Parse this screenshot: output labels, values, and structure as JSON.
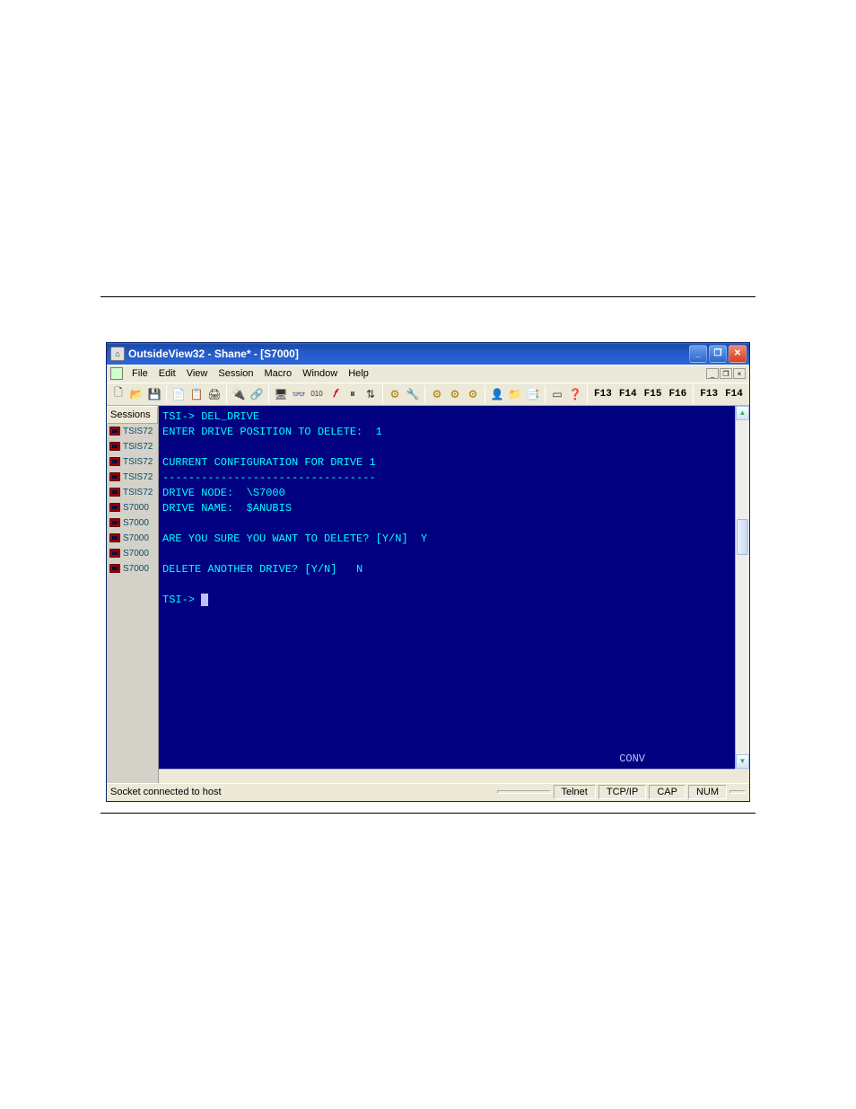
{
  "window": {
    "title": "OutsideView32 - Shane* - [S7000]"
  },
  "menus": [
    "File",
    "Edit",
    "View",
    "Session",
    "Macro",
    "Window",
    "Help"
  ],
  "toolbar": {
    "fkeys_right_a": [
      "F13",
      "F14",
      "F15",
      "F16"
    ],
    "fkeys_right_b": [
      "F13",
      "F14"
    ]
  },
  "sidebar": {
    "header": "Sessions",
    "items": [
      {
        "label": "TSIS72"
      },
      {
        "label": "TSIS72"
      },
      {
        "label": "TSIS72"
      },
      {
        "label": "TSIS72"
      },
      {
        "label": "TSIS72"
      },
      {
        "label": "S7000"
      },
      {
        "label": "S7000"
      },
      {
        "label": "S7000"
      },
      {
        "label": "S7000"
      },
      {
        "label": "S7000"
      }
    ]
  },
  "terminal": {
    "lines": [
      "TSI-> DEL_DRIVE",
      "ENTER DRIVE POSITION TO DELETE:  1",
      "",
      "CURRENT CONFIGURATION FOR DRIVE 1",
      "---------------------------------",
      "DRIVE NODE:  \\S7000",
      "DRIVE NAME:  $ANUBIS",
      "",
      "ARE YOU SURE YOU WANT TO DELETE? [Y/N]  Y",
      "",
      "DELETE ANOTHER DRIVE? [Y/N]   N",
      "",
      "TSI-> "
    ],
    "footer_right": "CONV"
  },
  "statusbar": {
    "message": "Socket connected to host",
    "panes": [
      "",
      "Telnet",
      "TCP/IP",
      "CAP",
      "NUM",
      ""
    ]
  }
}
